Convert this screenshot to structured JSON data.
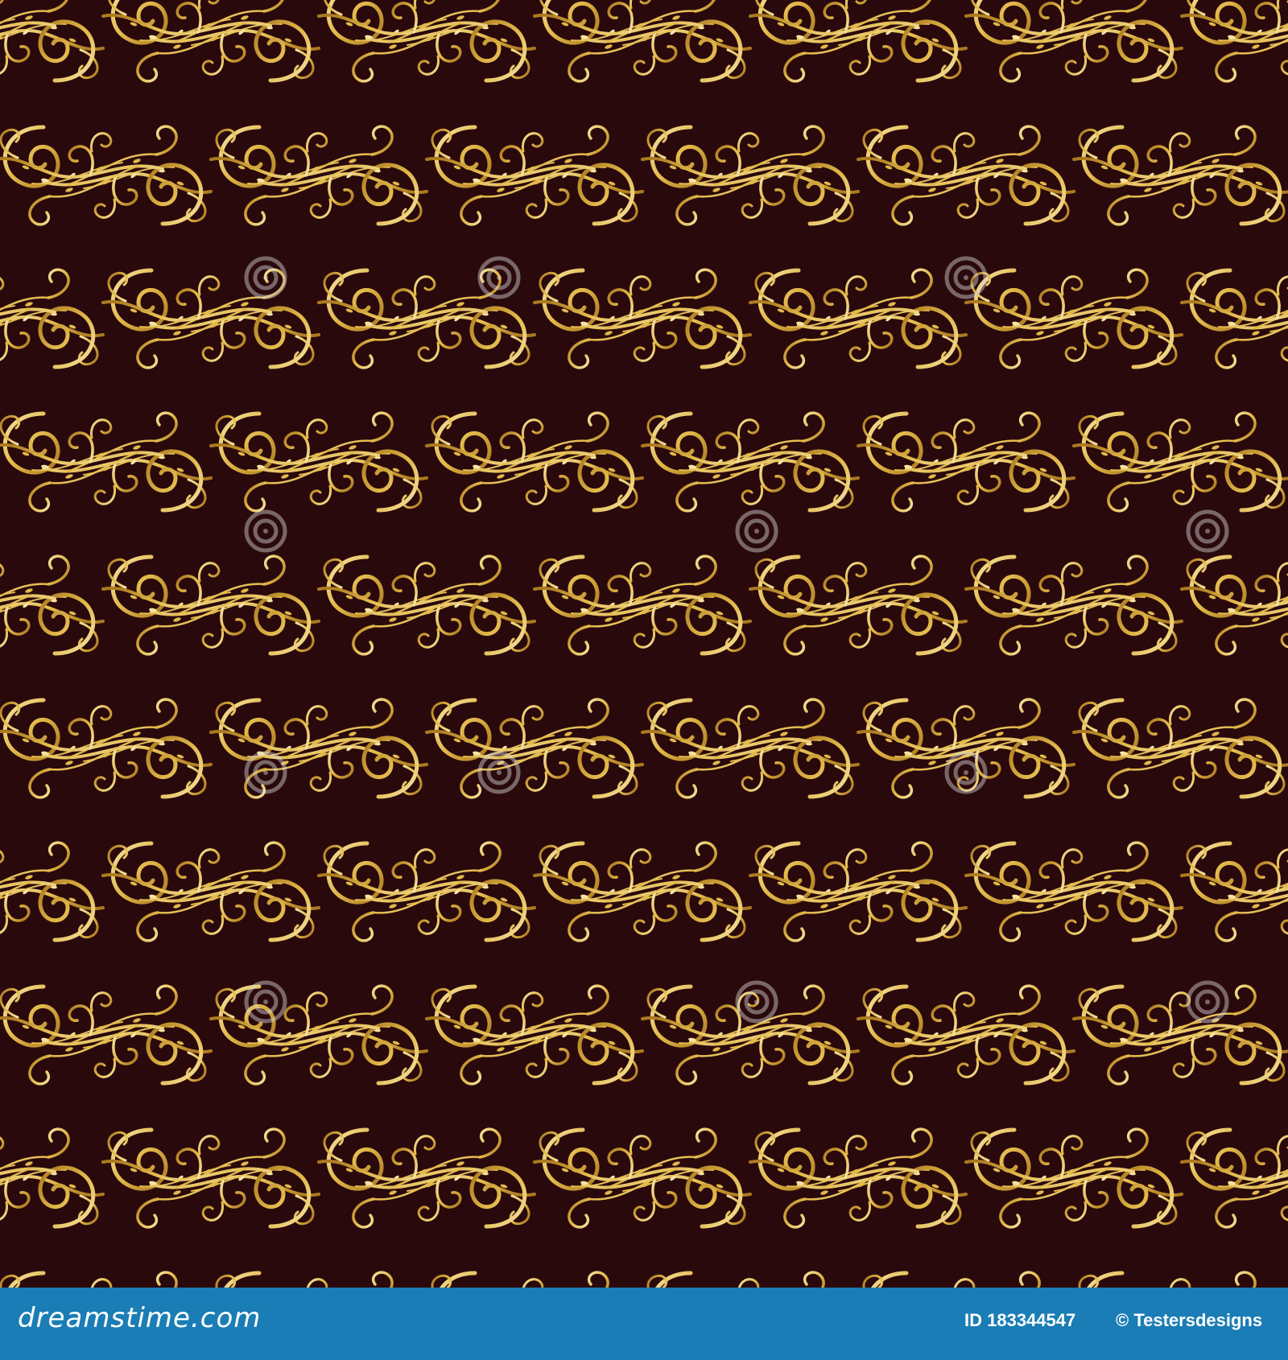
{
  "pattern": {
    "background_color": "#2a090c",
    "gold_light": "#f6e3a4",
    "gold_mid": "#e2b94a",
    "gold_dark": "#a9771d",
    "watermark_text": "dreamstime"
  },
  "stock_bar": {
    "background_color": "#1b7db5",
    "brand": "dreamstime.com",
    "image_id": "ID 183344547",
    "credit": "© Testersdesigns"
  }
}
